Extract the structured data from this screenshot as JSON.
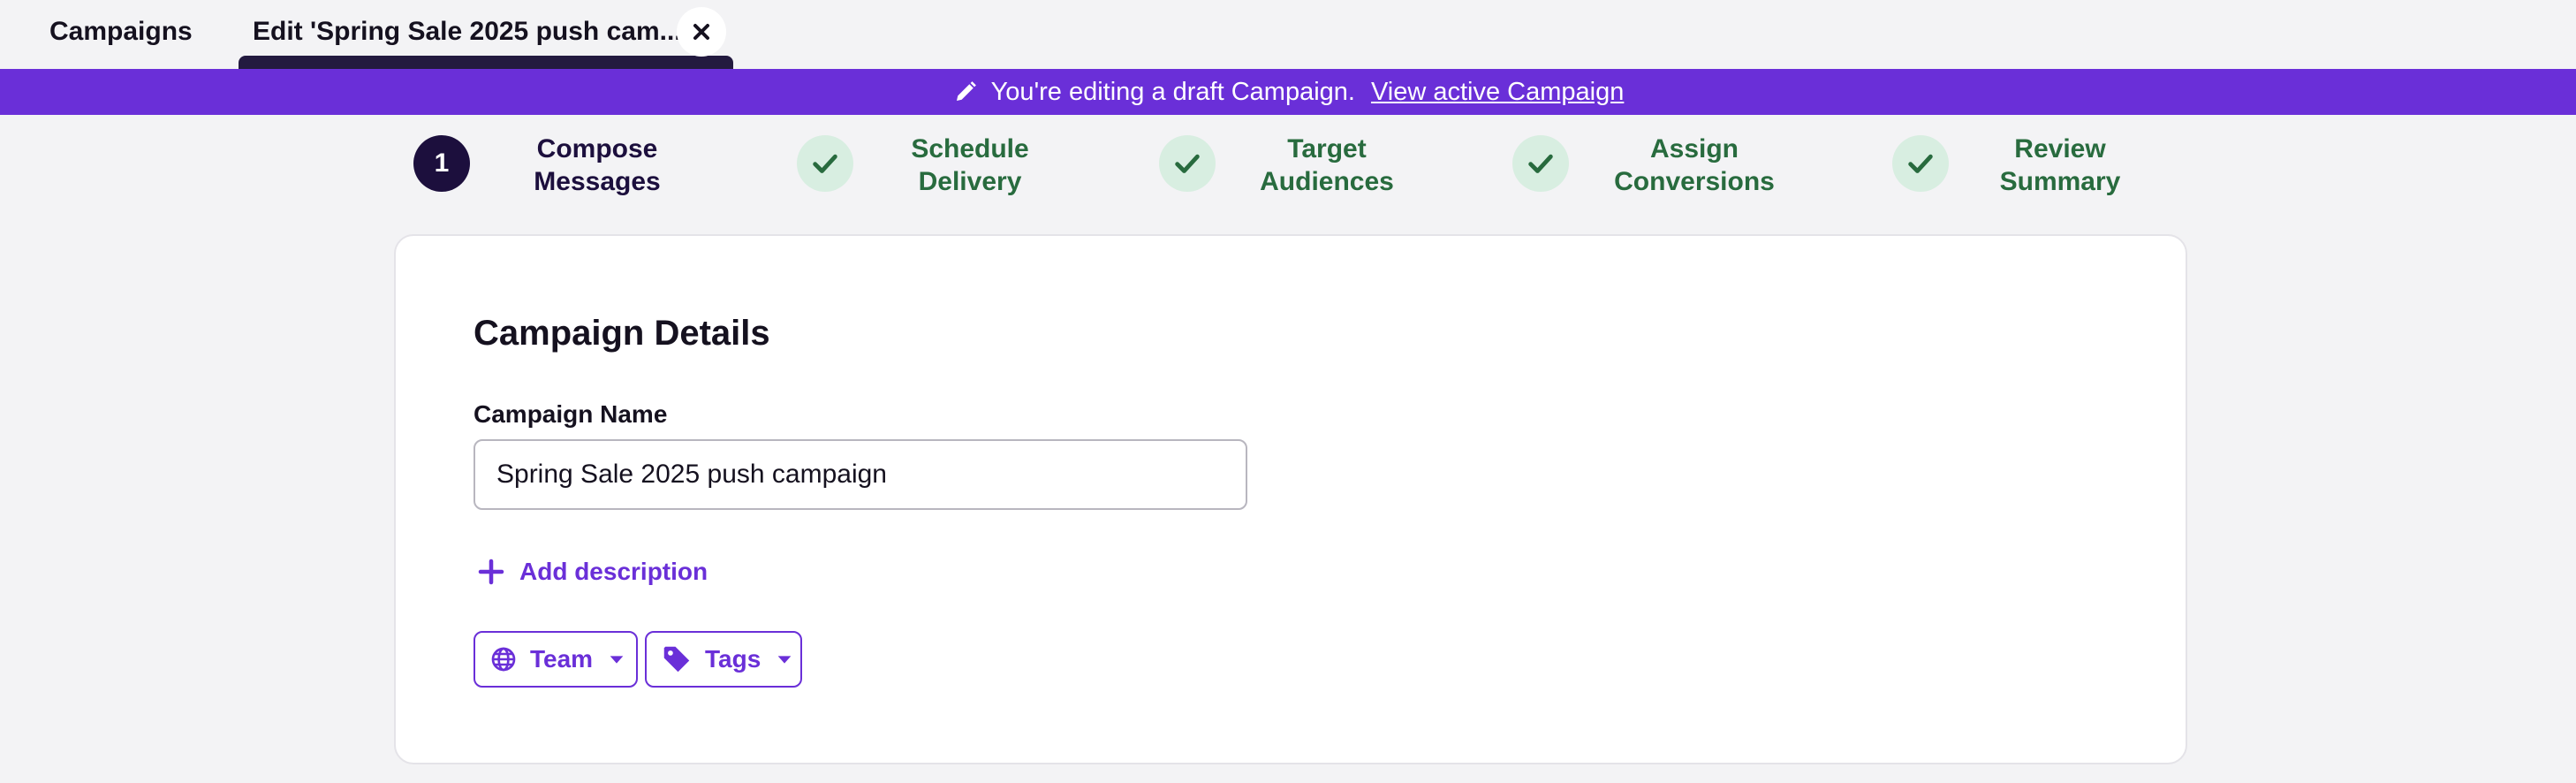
{
  "tabs": {
    "campaigns_label": "Campaigns",
    "edit_label": "Edit 'Spring Sale 2025 push cam..."
  },
  "banner": {
    "message": "You're editing a draft Campaign.",
    "link": "View active Campaign"
  },
  "stepper": {
    "steps": [
      {
        "number": "1",
        "line1": "Compose",
        "line2": "Messages",
        "state": "active"
      },
      {
        "line1": "Schedule",
        "line2": "Delivery",
        "state": "complete"
      },
      {
        "line1": "Target",
        "line2": "Audiences",
        "state": "complete"
      },
      {
        "line1": "Assign",
        "line2": "Conversions",
        "state": "complete"
      },
      {
        "line1": "Review",
        "line2": "Summary",
        "state": "complete"
      }
    ]
  },
  "details": {
    "title": "Campaign Details",
    "name_label": "Campaign Name",
    "name_value": "Spring Sale 2025 push campaign",
    "add_description": "Add description",
    "team_label": "Team",
    "tags_label": "Tags"
  },
  "colors": {
    "brand_purple": "#6a2fd8",
    "dark_navy": "#1c0f3d",
    "success_green": "#286b3e",
    "success_bg": "#d8eee1",
    "page_bg": "#f3f3f5"
  },
  "icons": {
    "close": "close-icon",
    "pencil": "pencil-icon",
    "check": "check-icon",
    "plus": "plus-icon",
    "globe": "globe-icon",
    "tag": "tag-icon",
    "caret": "caret-down-icon"
  }
}
